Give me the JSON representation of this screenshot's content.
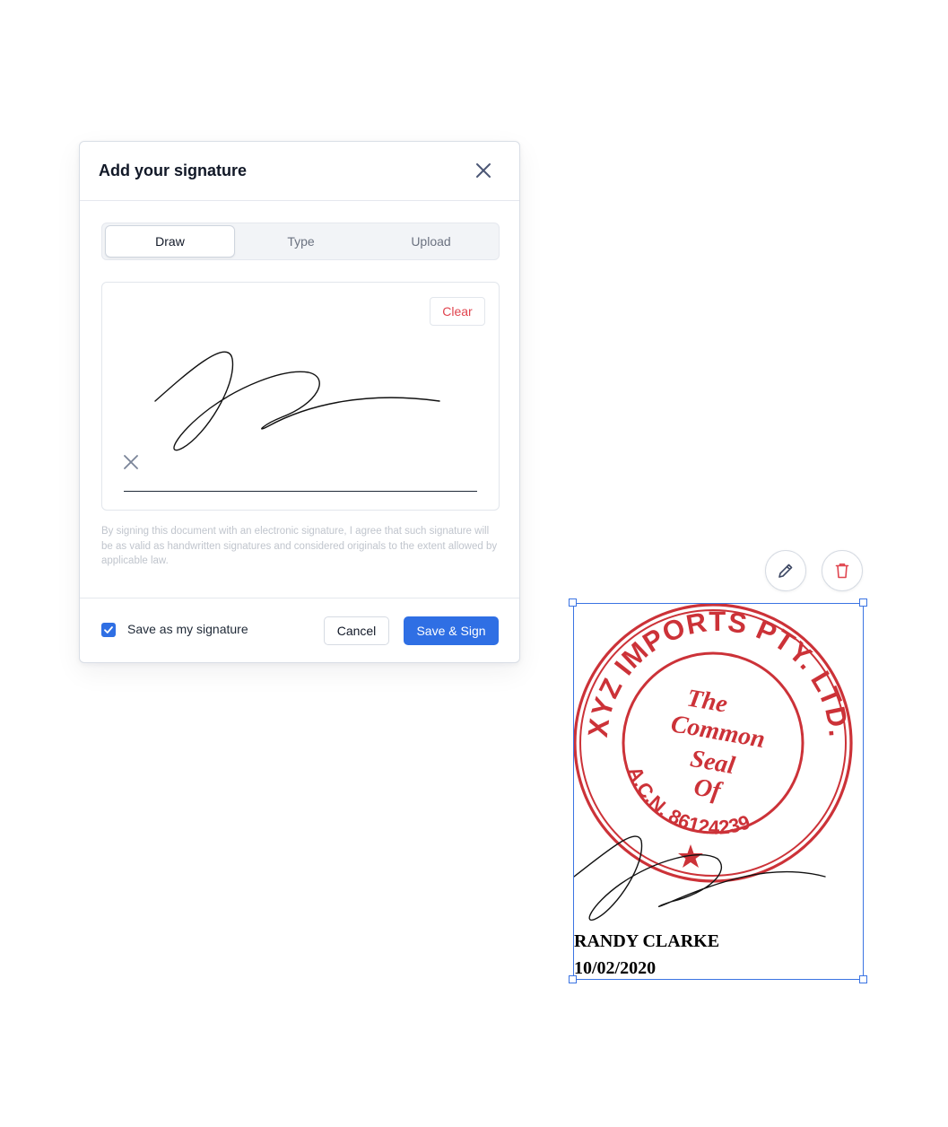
{
  "modal": {
    "title": "Add your signature",
    "close_icon": "close-icon",
    "tabs": [
      {
        "label": "Draw",
        "active": true
      },
      {
        "label": "Type",
        "active": false
      },
      {
        "label": "Upload",
        "active": false
      }
    ],
    "canvas": {
      "clear_label": "Clear",
      "sign_here_icon": "x-mark-icon"
    },
    "legal_text": "By signing this document with an electronic signature, I agree that such signature will be as valid as handwritten signatures and considered originals to the extent allowed by applicable law.",
    "footer": {
      "save_checkbox_checked": true,
      "save_checkbox_label": "Save as my signature",
      "cancel_label": "Cancel",
      "save_sign_label": "Save & Sign"
    }
  },
  "document": {
    "actions": [
      {
        "name": "edit",
        "icon": "pencil-icon"
      },
      {
        "name": "delete",
        "icon": "trash-icon"
      }
    ],
    "seal": {
      "outer_text": "XYZ IMPORTS PTY. LTD.",
      "inner_bottom_text": "A.C.N. 86124239",
      "center_lines": [
        "The",
        "Common",
        "Seal",
        "Of"
      ],
      "color": "#cc3238"
    },
    "signer_name": "RANDY CLARKE",
    "date": "10/02/2020"
  },
  "colors": {
    "accent": "#2f6fe4",
    "danger": "#e0454f",
    "seal_red": "#cc3238"
  }
}
